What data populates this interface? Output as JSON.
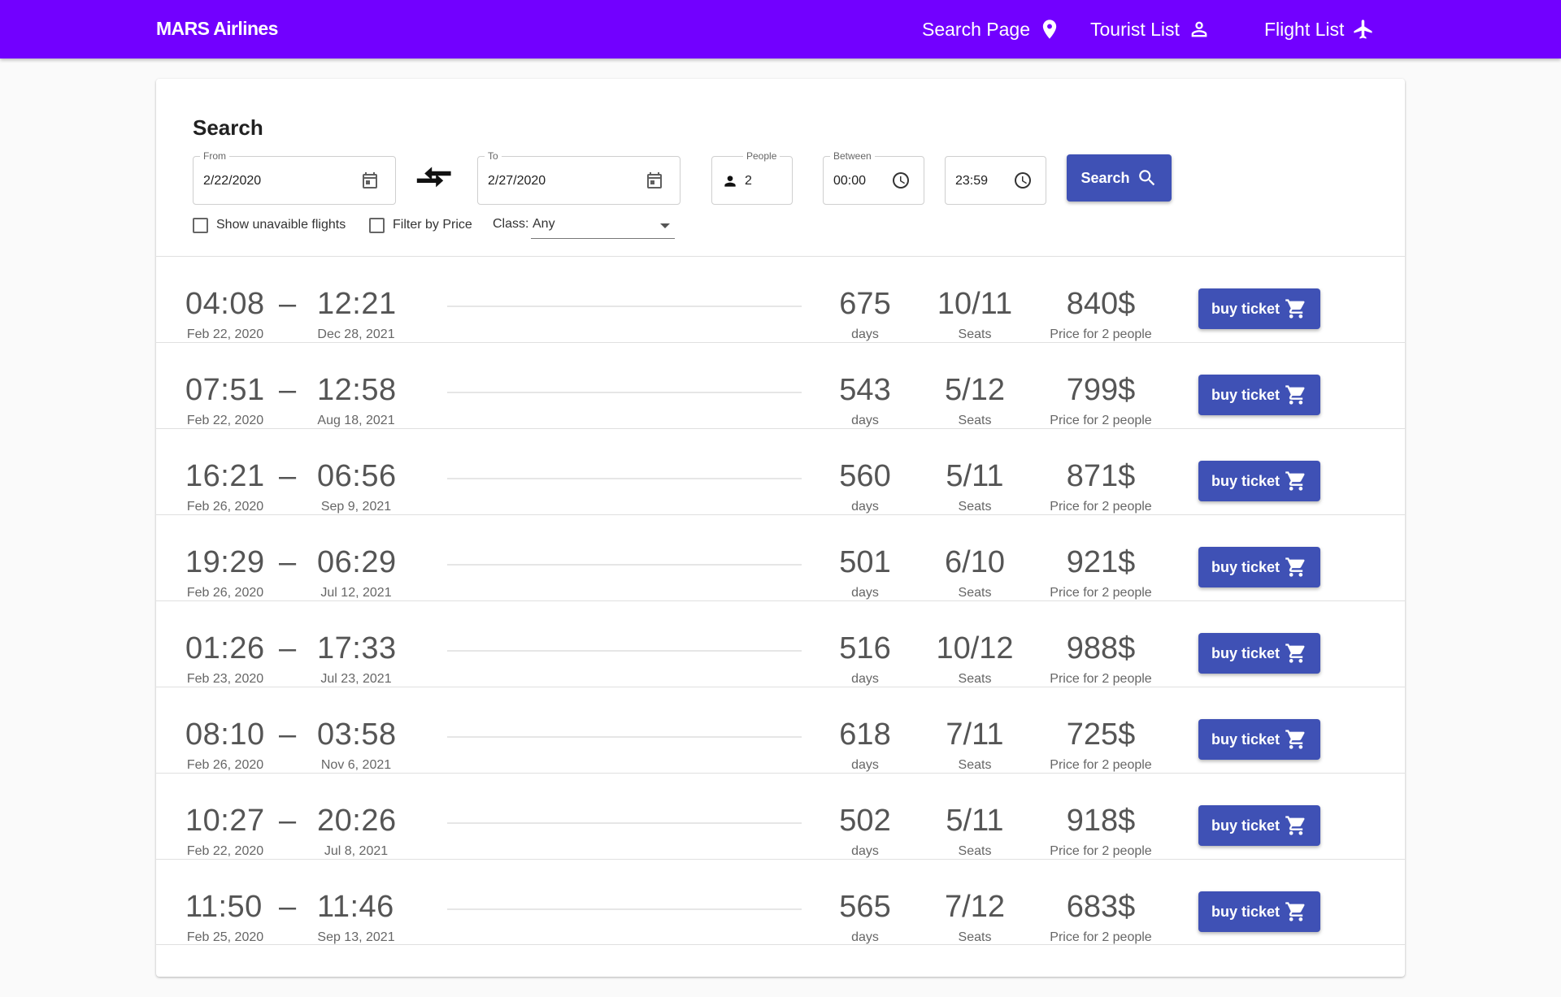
{
  "appbar": {
    "brand": "MARS Airlines",
    "nav": [
      {
        "label": "Search Page",
        "icon": "map-pin-icon"
      },
      {
        "label": "Tourist List",
        "icon": "person-icon"
      },
      {
        "label": "Flight List",
        "icon": "airplane-icon"
      }
    ],
    "color": "#7200ff"
  },
  "search": {
    "title": "Search",
    "from": {
      "label": "From",
      "value": "2/22/2020"
    },
    "to": {
      "label": "To",
      "value": "2/27/2020"
    },
    "people": {
      "label": "People",
      "value": "2"
    },
    "between": {
      "label": "Between",
      "start": "00:00",
      "end": "23:59"
    },
    "button_label": "Search",
    "show_unavailable_label": "Show unavaible flights",
    "filter_price_label": "Filter by Price",
    "class_label": "Class:",
    "class_value": "Any",
    "accent": "#3f51b5"
  },
  "flights": [
    {
      "dep_time": "04:08",
      "dep_date": "Feb 22, 2020",
      "arr_time": "12:21",
      "arr_date": "Dec 28, 2021",
      "days": "675",
      "days_label": "days",
      "seats": "10/11",
      "seats_label": "Seats",
      "price": "840$",
      "price_label": "Price for 2 people",
      "button": "buy ticket"
    },
    {
      "dep_time": "07:51",
      "dep_date": "Feb 22, 2020",
      "arr_time": "12:58",
      "arr_date": "Aug 18, 2021",
      "days": "543",
      "days_label": "days",
      "seats": "5/12",
      "seats_label": "Seats",
      "price": "799$",
      "price_label": "Price for 2 people",
      "button": "buy ticket"
    },
    {
      "dep_time": "16:21",
      "dep_date": "Feb 26, 2020",
      "arr_time": "06:56",
      "arr_date": "Sep 9, 2021",
      "days": "560",
      "days_label": "days",
      "seats": "5/11",
      "seats_label": "Seats",
      "price": "871$",
      "price_label": "Price for 2 people",
      "button": "buy ticket"
    },
    {
      "dep_time": "19:29",
      "dep_date": "Feb 26, 2020",
      "arr_time": "06:29",
      "arr_date": "Jul 12, 2021",
      "days": "501",
      "days_label": "days",
      "seats": "6/10",
      "seats_label": "Seats",
      "price": "921$",
      "price_label": "Price for 2 people",
      "button": "buy ticket"
    },
    {
      "dep_time": "01:26",
      "dep_date": "Feb 23, 2020",
      "arr_time": "17:33",
      "arr_date": "Jul 23, 2021",
      "days": "516",
      "days_label": "days",
      "seats": "10/12",
      "seats_label": "Seats",
      "price": "988$",
      "price_label": "Price for 2 people",
      "button": "buy ticket"
    },
    {
      "dep_time": "08:10",
      "dep_date": "Feb 26, 2020",
      "arr_time": "03:58",
      "arr_date": "Nov 6, 2021",
      "days": "618",
      "days_label": "days",
      "seats": "7/11",
      "seats_label": "Seats",
      "price": "725$",
      "price_label": "Price for 2 people",
      "button": "buy ticket"
    },
    {
      "dep_time": "10:27",
      "dep_date": "Feb 22, 2020",
      "arr_time": "20:26",
      "arr_date": "Jul 8, 2021",
      "days": "502",
      "days_label": "days",
      "seats": "5/11",
      "seats_label": "Seats",
      "price": "918$",
      "price_label": "Price for 2 people",
      "button": "buy ticket"
    },
    {
      "dep_time": "11:50",
      "dep_date": "Feb 25, 2020",
      "arr_time": "11:46",
      "arr_date": "Sep 13, 2021",
      "days": "565",
      "days_label": "days",
      "seats": "7/12",
      "seats_label": "Seats",
      "price": "683$",
      "price_label": "Price for 2 people",
      "button": "buy ticket"
    }
  ]
}
